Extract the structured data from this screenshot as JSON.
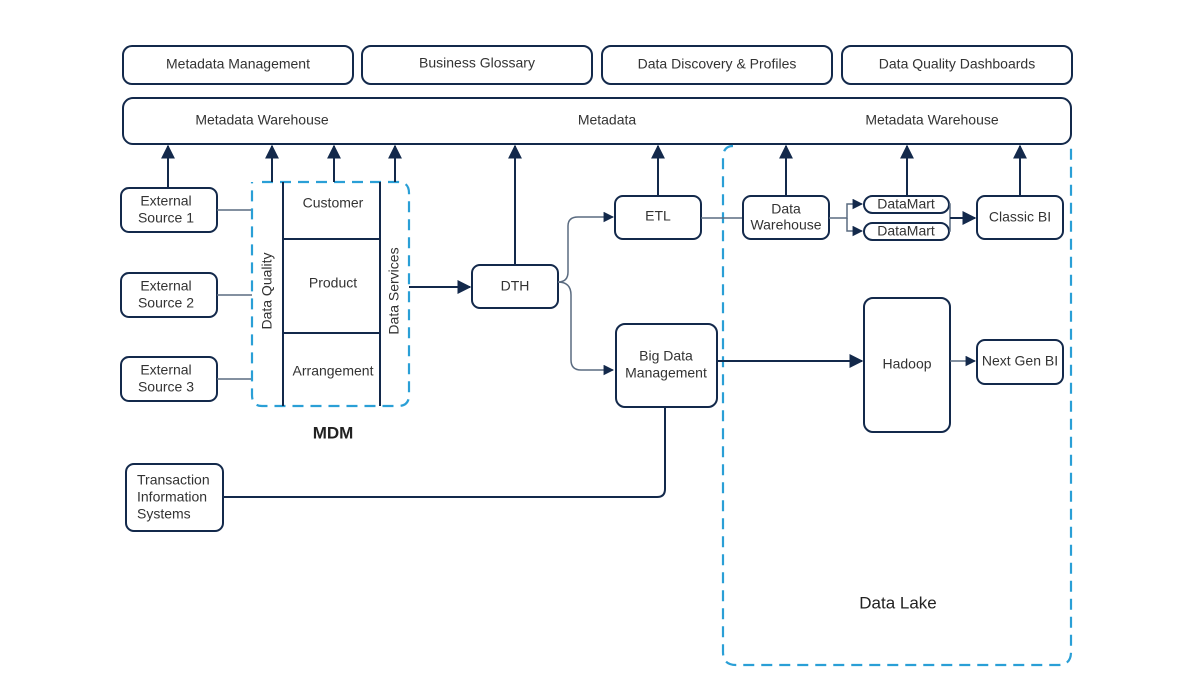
{
  "top_tools": [
    {
      "id": "metadata-management",
      "label": "Metadata Management"
    },
    {
      "id": "business-glossary",
      "label": "Business Glossary"
    },
    {
      "id": "data-discovery-profiles",
      "label": "Data Discovery & Profiles"
    },
    {
      "id": "data-quality-dashboards",
      "label": "Data Quality Dashboards"
    }
  ],
  "metadata_bar": {
    "labels": [
      "Metadata Warehouse",
      "Metadata",
      "Metadata Warehouse"
    ]
  },
  "sources": [
    {
      "id": "external-source-1",
      "lines": [
        "External",
        "Source 1"
      ]
    },
    {
      "id": "external-source-2",
      "lines": [
        "External",
        "Source 2"
      ]
    },
    {
      "id": "external-source-3",
      "lines": [
        "External",
        "Source 3"
      ]
    }
  ],
  "mdm": {
    "title": "MDM",
    "left_label": "Data Quality",
    "right_label": "Data Services",
    "domains": [
      "Customer",
      "Product",
      "Arrangement"
    ]
  },
  "transaction_systems": {
    "lines": [
      "Transaction",
      "Information",
      "Systems"
    ]
  },
  "nodes": {
    "dth": "DTH",
    "etl": "ETL",
    "big_data": [
      "Big Data",
      "Management"
    ],
    "data_warehouse": [
      "Data",
      "Warehouse"
    ],
    "datamart_1": "DataMart",
    "datamart_2": "DataMart",
    "classic_bi": "Classic BI",
    "hadoop": "Hadoop",
    "next_gen_bi": "Next Gen BI"
  },
  "data_lake": {
    "title": "Data Lake"
  },
  "colors": {
    "box_stroke": "#13294b",
    "dashed_group": "#2a9fd6",
    "connector": "#5a6b80",
    "text": "#333333"
  }
}
